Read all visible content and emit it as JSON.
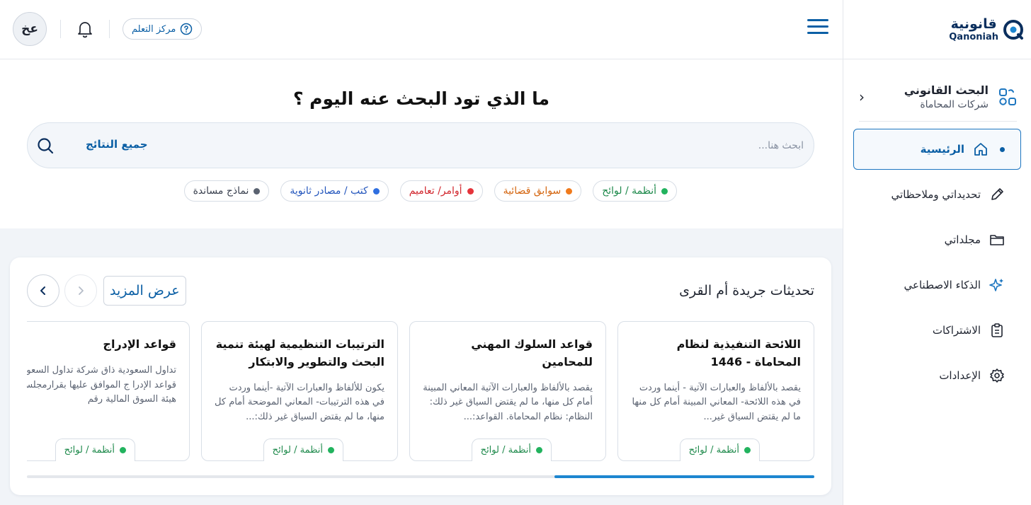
{
  "brand": {
    "name_ar": "قانونية",
    "name_en": "Qanoniah"
  },
  "sidebar": {
    "section_title": "البحث القانوني",
    "section_subtitle": "شركات المحاماة",
    "items": [
      {
        "label": "الرئيسية",
        "icon": "home-icon",
        "active": true
      },
      {
        "label": "تحديداتي وملاحظاتي",
        "icon": "pencil-icon"
      },
      {
        "label": "مجلداتي",
        "icon": "folder-icon"
      },
      {
        "label": "الذكاء الاصطناعي",
        "icon": "sparkle-icon"
      },
      {
        "label": "الاشتراكات",
        "icon": "clipboard-icon"
      },
      {
        "label": "الإعدادات",
        "icon": "gear-icon"
      }
    ]
  },
  "topbar": {
    "avatar_initials": "عخ",
    "learning_center": "مركز التعلم"
  },
  "search": {
    "heading": "ما الذي تود البحث عنه اليوم ؟",
    "placeholder": "ابحث هنا...",
    "scope": "جميع النتائج"
  },
  "filters": [
    {
      "label": "أنظمة / لوائح",
      "color": "#22b35e",
      "text_color": "#1f8a4c"
    },
    {
      "label": "سوابق قضائية",
      "color": "#f07a1c",
      "text_color": "#d4650f"
    },
    {
      "label": "أوامر/ تعاميم",
      "color": "#e5343b",
      "text_color": "#d1262d"
    },
    {
      "label": "كتب / مصادر ثانوية",
      "color": "#2f6fe0",
      "text_color": "#2557bd"
    },
    {
      "label": "نماذج مساندة",
      "color": "#5a6270",
      "text_color": "#3b4250"
    }
  ],
  "updates": {
    "title": "تحديثات جريدة أم القرى",
    "more_label": "عرض المزيد",
    "progress": 0.33,
    "cards": [
      {
        "title": "اللائحة التنفيذية لنظام المحاماة - 1446",
        "body": "يقصد بالألفاظ والعبارات الآتية - أينما وردت في هذه اللائحة- المعاني المبينة أمام كل منها ما لم يقتض السياق غير...",
        "tag": "أنظمة / لوائح"
      },
      {
        "title": "قواعد السلوك المهني للمحامين",
        "body": "يقصد بالألفاظ والعبارات الآتية المعاني المبينة أمام كل منها، ما لم يقتض السياق غير ذلك: النظام: نظام المحاماة. القواعد:...",
        "tag": "أنظمة / لوائح"
      },
      {
        "title": "الترتيبات التنظيمية لهيئة تنمية البحث والتطوير والابتكار",
        "body": "يكون للألفاظ والعبارات الآتية -أينما وردت في هذه الترتيبات- المعاني الموضحة أمام كل منها، ما لم يقتض السياق غير ذلك:...",
        "tag": "أنظمة / لوائح"
      },
      {
        "title": "قواعد الإدراج",
        "body": "تداول السعودية ذاق شركة تداول السعودية قواعد الإدرا ج الموافق عليها بقرارمجلس هيئة السوق المالية رقم",
        "tag": "أنظمة / لوائح"
      }
    ]
  }
}
